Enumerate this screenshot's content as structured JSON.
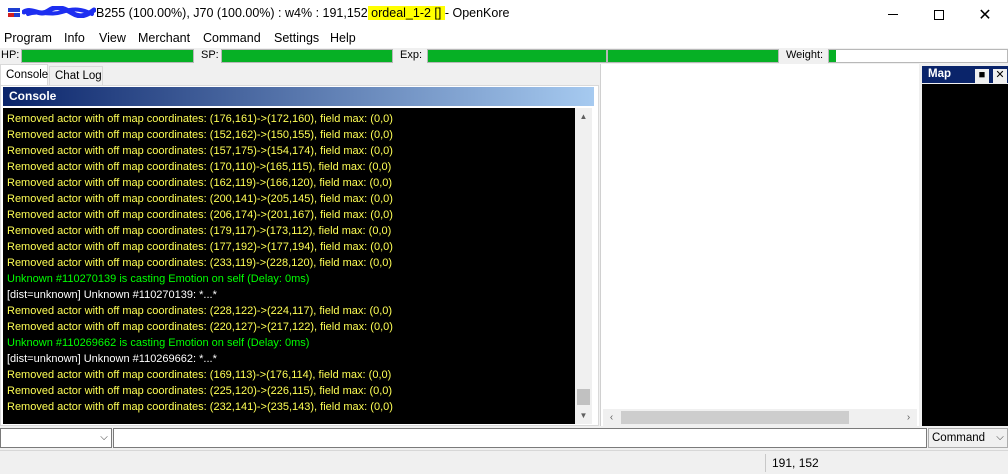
{
  "titlebar": {
    "title_part1": "B255 (100.00%), J70 (100.00%) : w4% : 191,152",
    "title_highlight": " ordeal_1-2 [] ",
    "title_part2": "- OpenKore",
    "redaction_color": "#1d2ef0"
  },
  "menu": [
    "Program",
    "Info",
    "View",
    "Merchant",
    "Command",
    "Settings",
    "Help"
  ],
  "stats": {
    "hp_label": "HP:",
    "sp_label": "SP:",
    "exp_label": "Exp:",
    "weight_label": "Weight:",
    "hp_fraction": 1.0,
    "sp_fraction": 1.0,
    "exp_fraction": 1.0,
    "exp2_fraction": 1.0,
    "weight_fraction": 0.04,
    "bar_color": "#06b025"
  },
  "tabs": [
    "Console",
    "Chat Log"
  ],
  "console": {
    "header": "Console",
    "lines": [
      {
        "text": "Removed actor with off map coordinates: (176,161)->(172,160), field max: (0,0)",
        "color": "yellow"
      },
      {
        "text": "Removed actor with off map coordinates: (152,162)->(150,155), field max: (0,0)",
        "color": "yellow"
      },
      {
        "text": "Removed actor with off map coordinates: (157,175)->(154,174), field max: (0,0)",
        "color": "yellow"
      },
      {
        "text": "Removed actor with off map coordinates: (170,110)->(165,115), field max: (0,0)",
        "color": "yellow"
      },
      {
        "text": "Removed actor with off map coordinates: (162,119)->(166,120), field max: (0,0)",
        "color": "yellow"
      },
      {
        "text": "Removed actor with off map coordinates: (200,141)->(205,145), field max: (0,0)",
        "color": "yellow"
      },
      {
        "text": "Removed actor with off map coordinates: (206,174)->(201,167), field max: (0,0)",
        "color": "yellow"
      },
      {
        "text": "Removed actor with off map coordinates: (179,117)->(173,112), field max: (0,0)",
        "color": "yellow"
      },
      {
        "text": "Removed actor with off map coordinates: (177,192)->(177,194), field max: (0,0)",
        "color": "yellow"
      },
      {
        "text": "Removed actor with off map coordinates: (233,119)->(228,120), field max: (0,0)",
        "color": "yellow"
      },
      {
        "text": "Unknown #110270139 is casting Emotion on self (Delay: 0ms)",
        "color": "green"
      },
      {
        "text": "[dist=unknown] Unknown #110270139: *...*",
        "color": "white"
      },
      {
        "text": "Removed actor with off map coordinates: (228,122)->(224,117), field max: (0,0)",
        "color": "yellow"
      },
      {
        "text": "Removed actor with off map coordinates: (220,127)->(217,122), field max: (0,0)",
        "color": "yellow"
      },
      {
        "text": "Unknown #110269662 is casting Emotion on self (Delay: 0ms)",
        "color": "green"
      },
      {
        "text": "[dist=unknown] Unknown #110269662: *...*",
        "color": "white"
      },
      {
        "text": "Removed actor with off map coordinates: (169,113)->(176,114), field max: (0,0)",
        "color": "yellow"
      },
      {
        "text": "Removed actor with off map coordinates: (225,120)->(226,115), field max: (0,0)",
        "color": "yellow"
      },
      {
        "text": "Removed actor with off map coordinates: (232,141)->(235,143), field max: (0,0)",
        "color": "yellow"
      }
    ]
  },
  "map": {
    "title": "Map",
    "restore_glyph": "■",
    "close_glyph": "✕"
  },
  "command": {
    "history_value": "",
    "input_value": "",
    "mode_value": "Command"
  },
  "status": {
    "coords": "191, 152"
  }
}
